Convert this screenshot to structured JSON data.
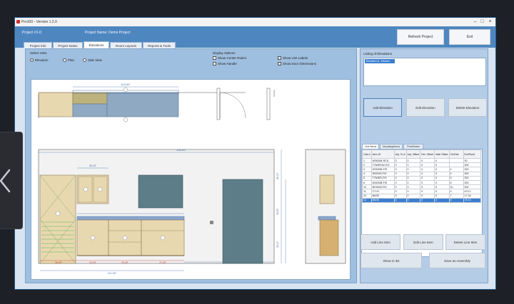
{
  "window": {
    "title": "Pro100 - Version 1.2.0",
    "controls": [
      "–",
      "□",
      "×"
    ]
  },
  "header": {
    "project_id": "Project #1-0",
    "project_name": "Project Name: Demo Project",
    "buttons": [
      "Refresh Project",
      "Exit"
    ]
  },
  "tabs": [
    {
      "label": "Project Info",
      "active": false
    },
    {
      "label": "Project Notes",
      "active": false
    },
    {
      "label": "Elevations",
      "active": true
    },
    {
      "label": "Room Layouts",
      "active": false
    },
    {
      "label": "Reports & Tools",
      "active": false
    }
  ],
  "view_mode": {
    "label": "Select View",
    "options": [
      {
        "label": "Elevation",
        "selected": true
      },
      {
        "label": "Plan",
        "selected": false
      },
      {
        "label": "Side View",
        "selected": false
      }
    ]
  },
  "display_options": {
    "label": "Display Options",
    "items": [
      {
        "label": "Show Center Rulers",
        "checked": false
      },
      {
        "label": "Show Handle",
        "checked": false
      },
      {
        "label": "Show Unit Labels",
        "checked": true
      },
      {
        "label": "Show Door Dimensions",
        "checked": true
      }
    ]
  },
  "drawing": {
    "dims": {
      "plan_top": "144.00\"",
      "wall_width": "156.00\"",
      "upper_left": "36.00\"",
      "lower_total": "111.00\"",
      "right_gap": "36.00\"",
      "heights": [
        "96.00\"",
        "34.50\"",
        "36.00\""
      ],
      "base_cells": [
        "36.00\"",
        "24.00\"",
        "30.00\"",
        "21.00\""
      ],
      "right_side": "36.00\""
    },
    "tags": [
      "1",
      "2",
      "3",
      "4",
      "5",
      "6",
      "7",
      "8",
      "9"
    ]
  },
  "elevations_list": {
    "label": "Listing of Elevations",
    "items": [
      {
        "label": "Elevation A - Kitchen",
        "selected": true
      }
    ]
  },
  "elevation_buttons": [
    "Add Elevation",
    "Edit Elevation",
    "Delete Elevation"
  ],
  "subtabs": [
    "Line Items",
    "Moulding/Items",
    "Print/Notes"
  ],
  "grid": {
    "columns": [
      "Cab #",
      "Item ID",
      "Adj. To #",
      "Adj. Offset",
      "Rel. Offset",
      "Wall Offset",
      "Ctr/Dist",
      "Ext/Posit"
    ],
    "rows": [
      [
        "1",
        "W3630B-RCD",
        "0",
        "0",
        "0",
        "0",
        "",
        "30"
      ],
      [
        "2",
        "TOWER42-RO",
        "0",
        "0",
        "0",
        "0",
        "",
        "300"
      ],
      [
        "3",
        "W3030B-FIS",
        "0",
        "0",
        "0",
        "0",
        "4",
        "300"
      ],
      [
        "4",
        "DB3030-FIS",
        "0",
        "0",
        "0",
        "0",
        "4",
        "300"
      ],
      [
        "5",
        "TOWER-FIS",
        "0",
        "0",
        "0",
        "0",
        "5",
        "300"
      ],
      [
        "6",
        "W3030B-FIS",
        "0",
        "0",
        "0",
        "0",
        "6",
        "300"
      ],
      [
        "10",
        "BO3030-FIS",
        "0",
        "0",
        "0",
        "0",
        "10",
        "300"
      ],
      [
        "11",
        "CT-97",
        "0",
        "0",
        "0",
        "0",
        "0",
        "473.2"
      ],
      [
        "12",
        "BASE",
        "0",
        "0",
        "0",
        "0",
        "7",
        "17.34"
      ],
      [
        "13",
        "BASE",
        "0",
        "0",
        "0",
        "0",
        "8",
        "75.13"
      ]
    ],
    "selected_row": 9
  },
  "line_item_buttons": [
    "Add Line Item",
    "Edit Line Item",
    "Delete Line Item"
  ],
  "bottom_buttons": [
    "Show in 3D",
    "Save as Assembly"
  ],
  "colors": {
    "window_frame": "#5b8fc4",
    "header": "#4e87c0",
    "panel": "#9fbfe0",
    "cabinet": "#e8d8b0",
    "cabinet_edge": "#8a7a55",
    "countertop": "#8aa6cc",
    "upper_highlight": "#8fa9c3",
    "accent": "#3c7fd0"
  }
}
